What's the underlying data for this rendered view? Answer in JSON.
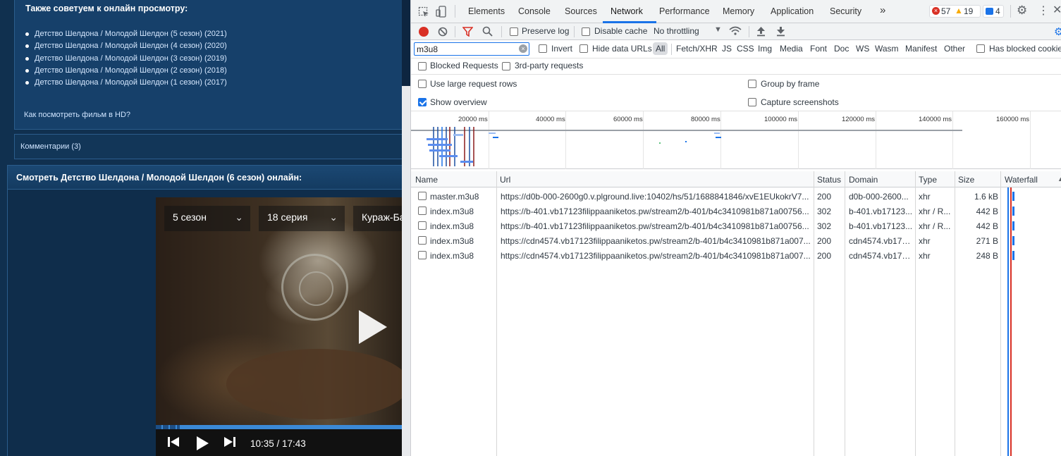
{
  "site": {
    "recs_title": "Также советуем к онлайн просмотру:",
    "recs": [
      "Детство Шелдона / Молодой Шелдон (5 сезон) (2021)",
      "Детство Шелдона / Молодой Шелдон (4 сезон) (2020)",
      "Детство Шелдона / Молодой Шелдон (3 сезон) (2019)",
      "Детство Шелдона / Молодой Шелдон (2 сезон) (2018)",
      "Детство Шелдона / Молодой Шелдон (1 сезон) (2017)"
    ],
    "hd_link": "Как посмотреть фильм в HD?",
    "comments": "Комментарии (3)",
    "watch_title": "Смотреть Детство Шелдона / Молодой Шелдон (6 сезон) онлайн:",
    "player": {
      "season": "5 сезон",
      "episode": "18 серия",
      "voice": "Кураж-Ба",
      "time": "10:35 / 17:43",
      "progress_fraction": 1.0
    }
  },
  "devtools": {
    "tabs": [
      "Elements",
      "Console",
      "Sources",
      "Network",
      "Performance",
      "Memory",
      "Application",
      "Security"
    ],
    "active_tab": "Network",
    "more_tabs": "»",
    "errors": "57",
    "warnings": "19",
    "messages": "4",
    "toolbar": {
      "preserve_log": "Preserve log",
      "disable_cache": "Disable cache",
      "throttling": "No throttling"
    },
    "filter": {
      "value": "m3u8",
      "invert": "Invert",
      "hide_data_urls": "Hide data URLs",
      "types": [
        "All",
        "Fetch/XHR",
        "JS",
        "CSS",
        "Img",
        "Media",
        "Font",
        "Doc",
        "WS",
        "Wasm",
        "Manifest",
        "Other"
      ],
      "has_blocked_cookies": "Has blocked cookie",
      "blocked_requests": "Blocked Requests",
      "third_party": "3rd-party requests"
    },
    "settings": {
      "large_rows": "Use large request rows",
      "group_by_frame": "Group by frame",
      "show_overview": "Show overview",
      "capture_screenshots": "Capture screenshots"
    },
    "overview_ticks": [
      "20000 ms",
      "40000 ms",
      "60000 ms",
      "80000 ms",
      "100000 ms",
      "120000 ms",
      "140000 ms",
      "160000 ms"
    ],
    "columns": [
      "Name",
      "Url",
      "Status",
      "Domain",
      "Type",
      "Size",
      "Waterfall"
    ],
    "requests": [
      {
        "name": "master.m3u8",
        "url": "https://d0b-000-2600g0.v.plground.live:10402/hs/51/1688841846/xvE1EUkokrV7...",
        "status": "200",
        "domain": "d0b-000-2600...",
        "type": "xhr",
        "size": "1.6 kB"
      },
      {
        "name": "index.m3u8",
        "url": "https://b-401.vb17123filippaaniketos.pw/stream2/b-401/b4c3410981b871a00756...",
        "status": "302",
        "domain": "b-401.vb17123...",
        "type": "xhr / R...",
        "size": "442 B"
      },
      {
        "name": "index.m3u8",
        "url": "https://b-401.vb17123filippaaniketos.pw/stream2/b-401/b4c3410981b871a00756...",
        "status": "302",
        "domain": "b-401.vb17123...",
        "type": "xhr / R...",
        "size": "442 B"
      },
      {
        "name": "index.m3u8",
        "url": "https://cdn4574.vb17123filippaaniketos.pw/stream2/b-401/b4c3410981b871a007...",
        "status": "200",
        "domain": "cdn4574.vb171...",
        "type": "xhr",
        "size": "271 B"
      },
      {
        "name": "index.m3u8",
        "url": "https://cdn4574.vb17123filippaaniketos.pw/stream2/b-401/b4c3410981b871a007...",
        "status": "200",
        "domain": "cdn4574.vb171...",
        "type": "xhr",
        "size": "248 B"
      }
    ],
    "colors": {
      "accent": "#1a73e8",
      "error": "#d93025",
      "warning": "#f9ab00",
      "record": "#d93025"
    }
  }
}
